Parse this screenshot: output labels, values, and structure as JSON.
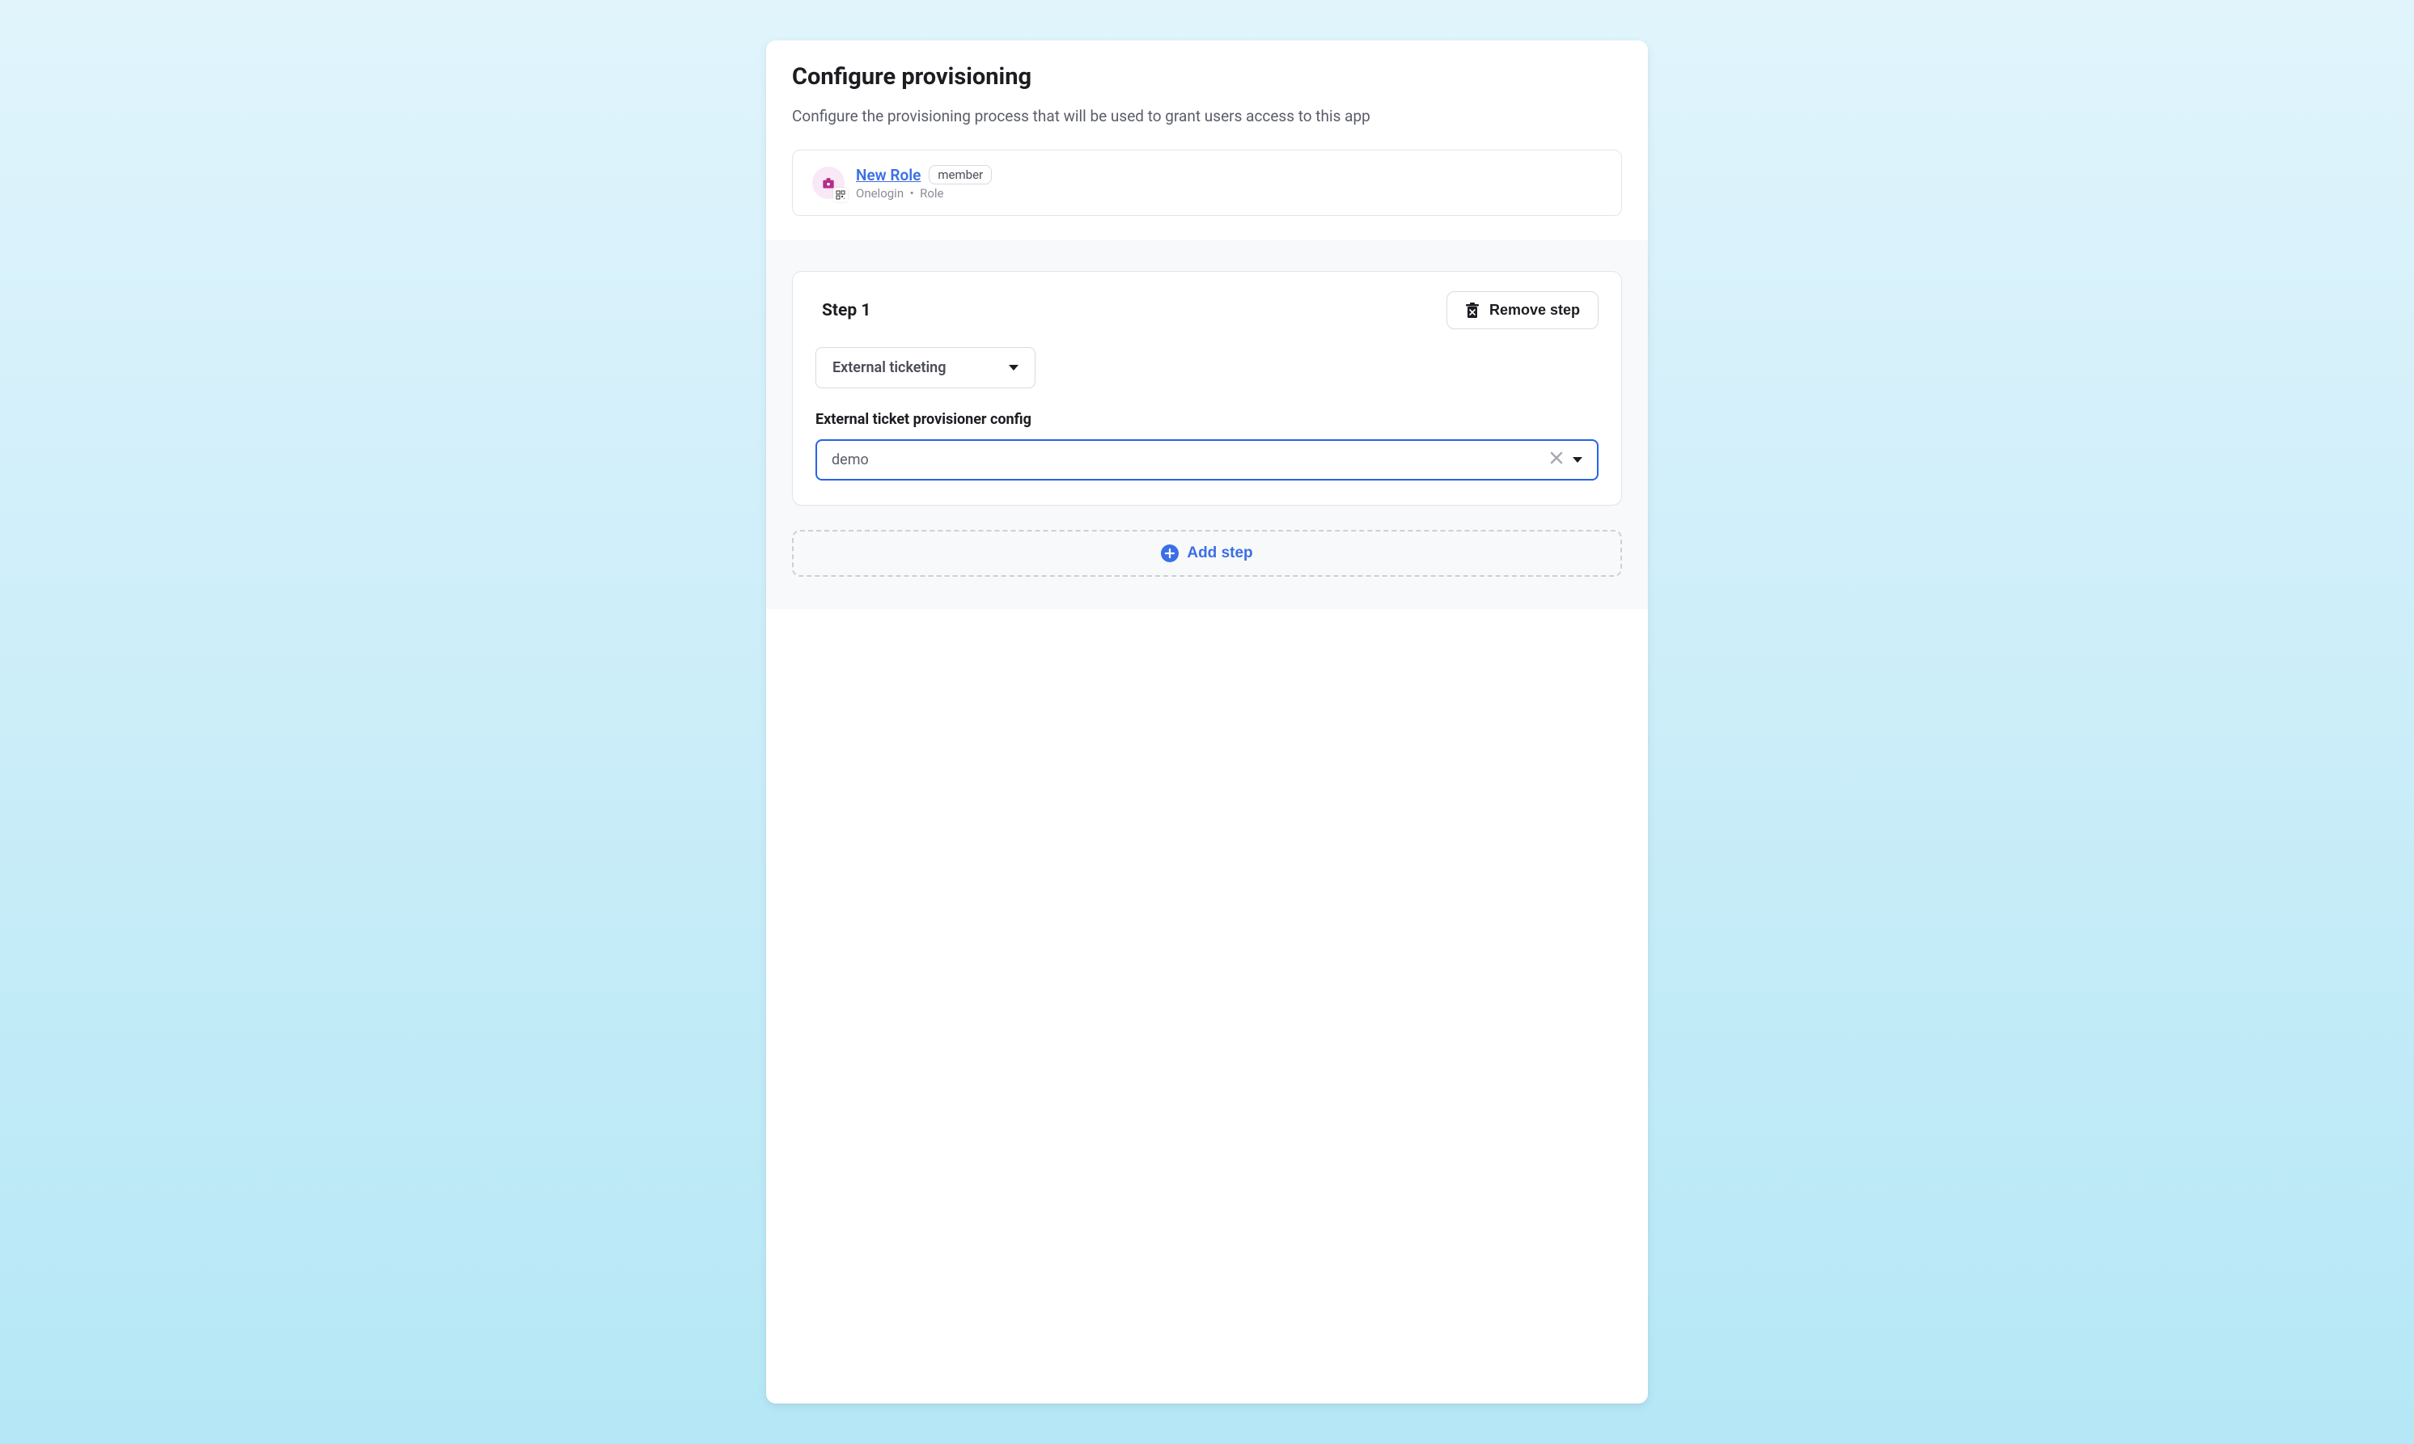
{
  "header": {
    "title": "Configure provisioning",
    "description": "Configure the provisioning process that will be used to grant users access to this app"
  },
  "role": {
    "name": "New Role",
    "badge": "member",
    "provider": "Onelogin",
    "type": "Role"
  },
  "step": {
    "title": "Step 1",
    "remove_label": "Remove step",
    "type_dropdown": "External ticketing",
    "config_label": "External ticket provisioner config",
    "config_value": "demo"
  },
  "add_step_label": "Add step"
}
